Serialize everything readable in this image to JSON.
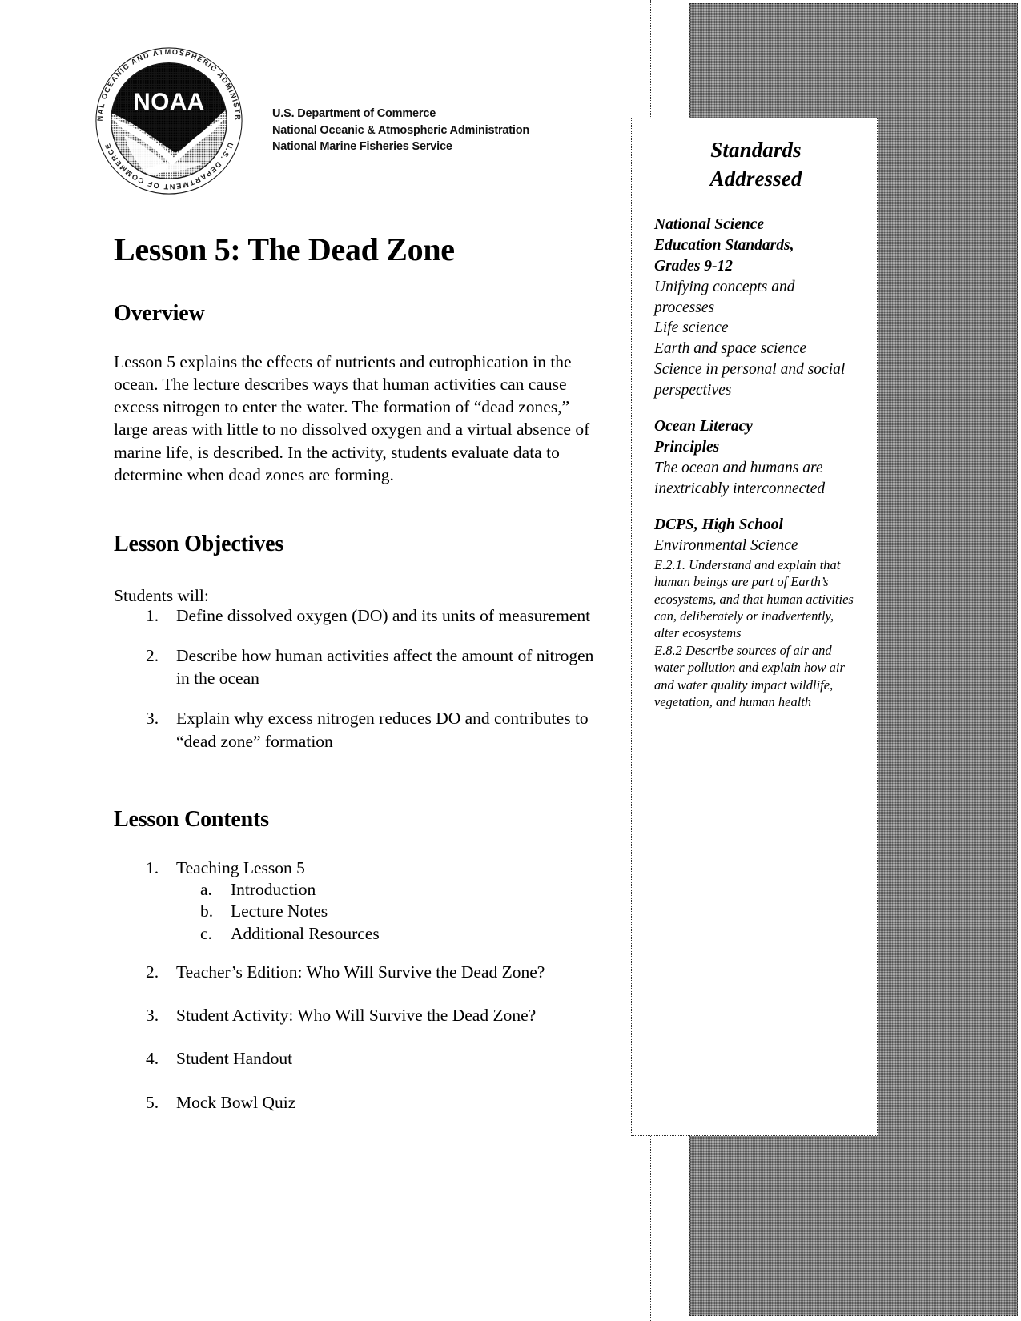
{
  "masthead": {
    "seal_text": "NOAA",
    "seal_ring_top": "NATIONAL OCEANIC AND ATMOSPHERIC ADMINISTRATION",
    "seal_ring_bottom": "U.S. DEPARTMENT OF COMMERCE",
    "agency_lines": [
      "U.S. Department of Commerce",
      "National Oceanic & Atmospheric Administration",
      "National Marine Fisheries Service"
    ]
  },
  "document": {
    "title": "Lesson 5: The Dead Zone"
  },
  "overview": {
    "heading": "Overview",
    "body": "Lesson 5 explains the effects of nutrients and eutrophication in the ocean. The lecture describes ways that human activities can cause excess nitrogen to enter the water. The formation of “dead zones,” large areas with little to no dissolved oxygen and a virtual absence of marine life, is described. In the activity, students evaluate data to determine when dead zones are forming."
  },
  "objectives": {
    "heading": "Lesson Objectives",
    "intro": "Students will:",
    "items": [
      {
        "marker": "1.",
        "text": "Define dissolved oxygen (DO) and its units of measurement"
      },
      {
        "marker": "2.",
        "text": "Describe how human activities affect the amount of nitrogen in the ocean"
      },
      {
        "marker": "3.",
        "text": "Explain why excess nitrogen reduces DO and contributes to “dead zone” formation"
      }
    ]
  },
  "contents": {
    "heading": "Lesson Contents",
    "items": [
      {
        "marker": "1.",
        "text": "Teaching Lesson 5",
        "subitems": [
          {
            "marker": "a.",
            "text": "Introduction"
          },
          {
            "marker": "b.",
            "text": "Lecture Notes"
          },
          {
            "marker": "c.",
            "text": "Additional Resources"
          }
        ]
      },
      {
        "marker": "2.",
        "text": "Teacher’s Edition: Who Will Survive the Dead Zone?",
        "subitems": []
      },
      {
        "marker": "3.",
        "text": "Student Activity: Who Will Survive the Dead Zone?",
        "subitems": []
      },
      {
        "marker": "4.",
        "text": "Student Handout",
        "subitems": []
      },
      {
        "marker": "5.",
        "text": "Mock Bowl Quiz",
        "subitems": []
      }
    ]
  },
  "standards": {
    "title": "Standards Addressed",
    "groups": [
      {
        "heading": [
          "National Science",
          "Education Standards,",
          "Grades 9-12"
        ],
        "items": [
          "Unifying concepts and processes",
          "Life science",
          "Earth and space science",
          "Science in personal and social perspectives"
        ],
        "small_items": []
      },
      {
        "heading": [
          "Ocean Literacy",
          "Principles"
        ],
        "items": [
          "The ocean and humans are inextricably interconnected"
        ],
        "small_items": []
      },
      {
        "heading": [
          "DCPS, High School"
        ],
        "items": [
          "Environmental Science"
        ],
        "small_items": [
          "E.2.1. Understand and explain that human beings are part of Earth’s ecosystems, and that human activities can, deliberately or inadvertently, alter ecosystems",
          "E.8.2 Describe sources of air and water pollution and explain how air and water quality impact wildlife, vegetation, and human health"
        ]
      }
    ]
  },
  "colors": {
    "text": "#000000",
    "page_background": "#ffffff",
    "side_band": "#8a8a8a",
    "border": "#2b2b2b"
  }
}
